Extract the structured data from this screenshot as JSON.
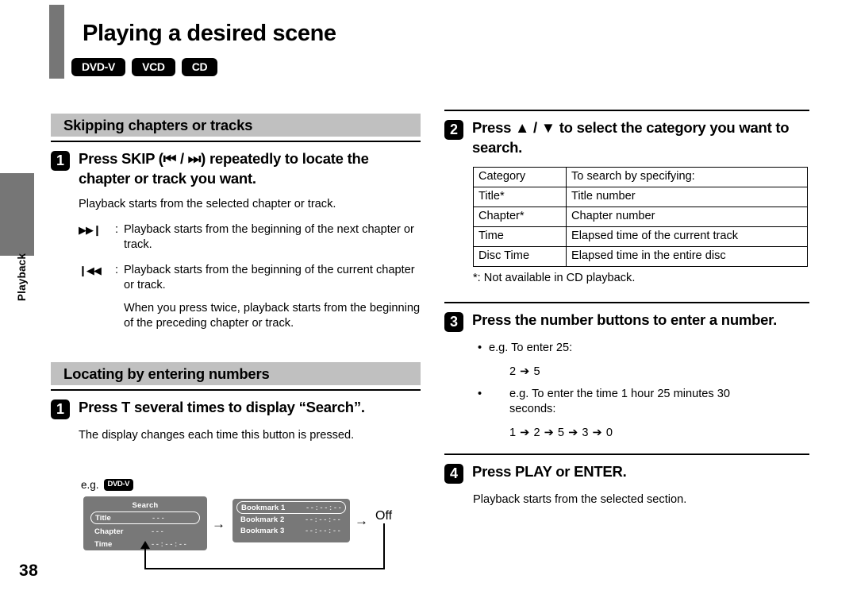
{
  "side_tab": {
    "label": "Playback"
  },
  "page_number": "38",
  "header": {
    "title": "Playing a desired scene",
    "badges": [
      "DVD-V",
      "VCD",
      "CD"
    ]
  },
  "left_column": {
    "section1": {
      "heading": "Skipping chapters or tracks",
      "step": {
        "number": "1",
        "title": "Press SKIP (⏮ / ⏭) repeatedly to locate the chapter or track you want."
      },
      "intro": "Playback starts from the selected chapter or track.",
      "definitions": [
        {
          "key": "▶▶❙",
          "colon": ":",
          "lines": [
            "Playback starts from the beginning of the next chapter or track."
          ]
        },
        {
          "key": "❙◀◀",
          "colon": ":",
          "lines": [
            "Playback starts from the beginning of the current chapter or track.",
            "When you press twice, playback starts from the beginning of the preceding chapter or track."
          ]
        }
      ]
    },
    "section2": {
      "heading": "Locating by entering numbers",
      "step": {
        "number": "1",
        "title": "Press T several times to display “Search”."
      },
      "body": "The display changes each time this button is pressed.",
      "diagram": {
        "eg_label": "e.g.",
        "eg_badge": "DVD-V",
        "search_panel": {
          "title": "Search",
          "rows": [
            {
              "label": "Title",
              "value": "- - -",
              "highlighted": true
            },
            {
              "label": "Chapter",
              "value": "- - -",
              "highlighted": false
            },
            {
              "label": "Time",
              "value": "- - : - - : - -",
              "highlighted": false
            }
          ]
        },
        "arrow1": "→",
        "bookmark_panel": {
          "rows": [
            {
              "label": "Bookmark 1",
              "value": "- - : - - : - -",
              "highlighted": true
            },
            {
              "label": "Bookmark 2",
              "value": "- - : - - : - -",
              "highlighted": false
            },
            {
              "label": "Bookmark 3",
              "value": "- - : - - : - -",
              "highlighted": false
            }
          ]
        },
        "arrow2": "→",
        "off_label": "Off"
      }
    }
  },
  "right_column": {
    "step2": {
      "number": "2",
      "title": "Press ▲ / ▼ to select the category you want to search.",
      "table": {
        "headers": [
          "Category",
          "To search by specifying:"
        ],
        "rows": [
          [
            "Title*",
            "Title number"
          ],
          [
            "Chapter*",
            "Chapter number"
          ],
          [
            "Time",
            "Elapsed time of the current track"
          ],
          [
            "Disc Time",
            "Elapsed time in the entire disc"
          ]
        ]
      },
      "note": "*: Not available in CD playback."
    },
    "step3": {
      "number": "3",
      "title": "Press the number buttons to enter a number.",
      "bullets": [
        {
          "dot": "•",
          "text": "e.g. To enter 25:",
          "sequence": "2 ➔ 5"
        },
        {
          "dot": "•",
          "text": "e.g. To enter the time 1 hour 25 minutes 30 seconds:",
          "sequence": "1 ➔ 2 ➔ 5 ➔ 3 ➔ 0"
        }
      ]
    },
    "step4": {
      "number": "4",
      "title": "Press PLAY or ENTER.",
      "body": "Playback starts from the selected section."
    }
  }
}
